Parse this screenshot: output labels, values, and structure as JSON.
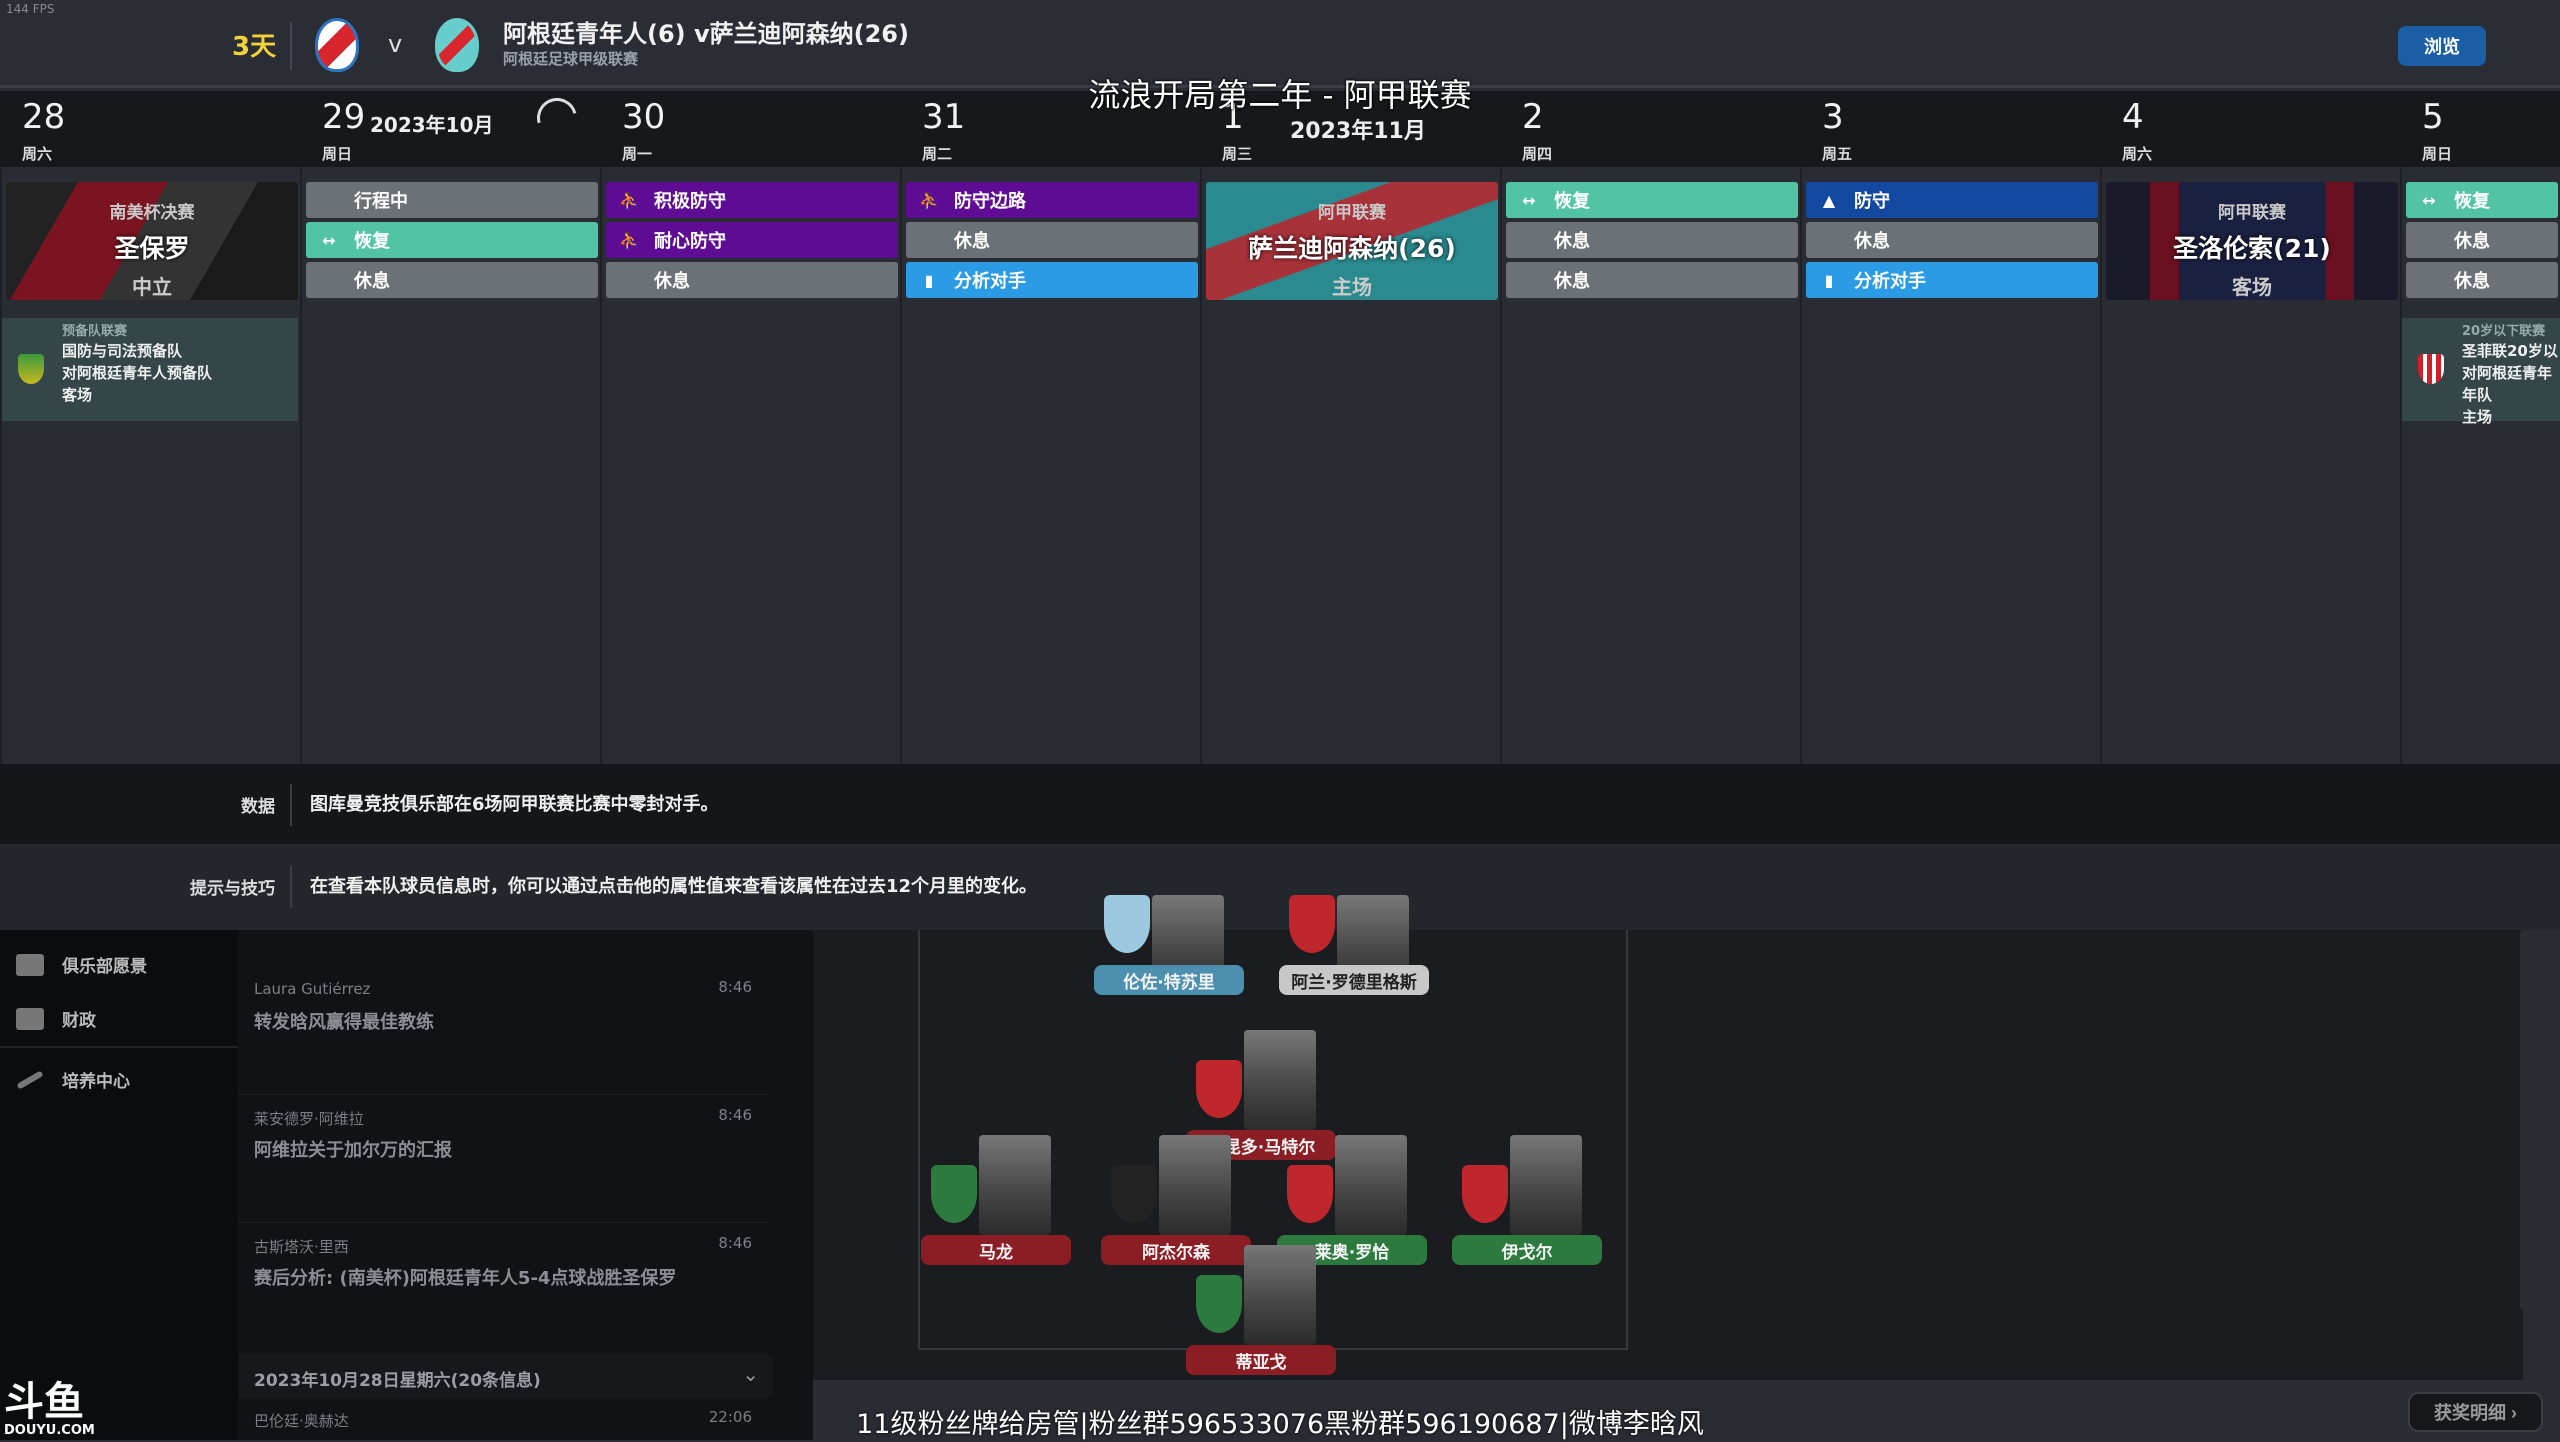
{
  "fps": "144 FPS",
  "header": {
    "countdown": "3天",
    "vs": "v",
    "title": "阿根廷青年人(6) v萨兰迪阿森纳(26)",
    "competition": "阿根廷足球甲级联赛",
    "browse_label": "浏览"
  },
  "stream_title": "流浪开局第二年 - 阿甲联赛",
  "days": [
    {
      "num": "28",
      "weekday": "周六",
      "month": ""
    },
    {
      "num": "29",
      "weekday": "周日",
      "month": "2023年10月"
    },
    {
      "num": "30",
      "weekday": "周一",
      "month": ""
    },
    {
      "num": "31",
      "weekday": "周二",
      "month": ""
    },
    {
      "num": "1",
      "weekday": "周三",
      "month": "2023年11月"
    },
    {
      "num": "2",
      "weekday": "周四",
      "month": ""
    },
    {
      "num": "3",
      "weekday": "周五",
      "month": ""
    },
    {
      "num": "4",
      "weekday": "周六",
      "month": ""
    },
    {
      "num": "5",
      "weekday": "周日",
      "month": ""
    }
  ],
  "schedule": [
    {
      "match": {
        "competition": "南美杯决赛",
        "opponent": "圣保罗",
        "venue": "中立"
      }
    },
    {
      "sessions": [
        {
          "label": "行程中",
          "color": "gray",
          "icon": ""
        },
        {
          "label": "恢复",
          "color": "green",
          "icon": "recovery-icon"
        },
        {
          "label": "休息",
          "color": "gray",
          "icon": ""
        }
      ]
    },
    {
      "sessions": [
        {
          "label": "积极防守",
          "color": "purple",
          "icon": "tackle-icon"
        },
        {
          "label": "耐心防守",
          "color": "purple",
          "icon": "tackle-icon"
        },
        {
          "label": "休息",
          "color": "gray",
          "icon": ""
        }
      ]
    },
    {
      "sessions": [
        {
          "label": "防守边路",
          "color": "purple",
          "icon": "tackle-icon"
        },
        {
          "label": "休息",
          "color": "gray",
          "icon": ""
        },
        {
          "label": "分析对手",
          "color": "lblue",
          "icon": "clipboard-icon"
        }
      ]
    },
    {
      "match": {
        "competition": "阿甲联赛",
        "opponent": "萨兰迪阿森纳(26)",
        "venue": "主场"
      }
    },
    {
      "sessions": [
        {
          "label": "恢复",
          "color": "green",
          "icon": "recovery-icon"
        },
        {
          "label": "休息",
          "color": "gray",
          "icon": ""
        },
        {
          "label": "休息",
          "color": "gray",
          "icon": ""
        }
      ]
    },
    {
      "sessions": [
        {
          "label": "防守",
          "color": "dblue",
          "icon": "defense-icon"
        },
        {
          "label": "休息",
          "color": "gray",
          "icon": ""
        },
        {
          "label": "分析对手",
          "color": "lblue",
          "icon": "clipboard-icon"
        }
      ]
    },
    {
      "match": {
        "competition": "阿甲联赛",
        "opponent": "圣洛伦索(21)",
        "venue": "客场"
      }
    },
    {
      "sessions": [
        {
          "label": "恢复",
          "color": "green",
          "icon": "recovery-icon"
        },
        {
          "label": "休息",
          "color": "gray",
          "icon": ""
        },
        {
          "label": "休息",
          "color": "gray",
          "icon": ""
        }
      ]
    }
  ],
  "reserve_events": [
    {
      "competition": "预备队联赛",
      "lines": [
        "国防与司法预备队",
        "对阿根廷青年人预备队",
        "客场"
      ]
    },
    {
      "competition": "20岁以下联赛",
      "lines": [
        "圣菲联20岁以",
        "对阿根廷青年",
        "年队",
        "主场"
      ]
    }
  ],
  "fact": {
    "label": "数据",
    "text": "图库曼竞技俱乐部在6场阿甲联赛比赛中零封对手。"
  },
  "tip": {
    "label": "提示与技巧",
    "text": "在查看本队球员信息时，你可以通过点击他的属性值来查看该属性在过去12个月里的变化。"
  },
  "sidebar": [
    {
      "label": "俱乐部愿景",
      "icon": "briefcase-icon"
    },
    {
      "label": "财政",
      "icon": "money-icon"
    },
    {
      "label": "培养中心",
      "icon": "growth-icon"
    }
  ],
  "news": [
    {
      "from": "Laura Gutiérrez",
      "time": "8:46",
      "subject": "转发晗风赢得最佳教练"
    },
    {
      "from": "莱安德罗·阿维拉",
      "time": "8:46",
      "subject": "阿维拉关于加尔万的汇报"
    },
    {
      "from": "古斯塔沃·里西",
      "time": "8:46",
      "subject": "赛后分析: (南美杯)阿根廷青年人5-4点球战胜圣保罗"
    }
  ],
  "news_group": {
    "label": "2023年10月28日星期六(20条信息)",
    "next_from": "巴伦廷·奥赫达",
    "next_time": "22:06"
  },
  "formation": [
    {
      "name": "伦佐·特苏里",
      "color": "lb"
    },
    {
      "name": "阿兰·罗德里格斯",
      "color": "wh"
    },
    {
      "name": "法昆多·马特尔",
      "color": "red"
    },
    {
      "name": "马龙",
      "color": "red"
    },
    {
      "name": "阿杰尔森",
      "color": "red"
    },
    {
      "name": "莱奥·罗恰",
      "color": "grn"
    },
    {
      "name": "伊戈尔",
      "color": "grn"
    },
    {
      "name": "蒂亚戈",
      "color": "red"
    }
  ],
  "stream_footer": "11级粉丝牌给房管|粉丝群596533076黑粉群596190687|微博李晗风",
  "awards_label": "获奖明细 ›",
  "watermark": {
    "logo": "斗鱼",
    "domain": "DOUYU.COM"
  }
}
